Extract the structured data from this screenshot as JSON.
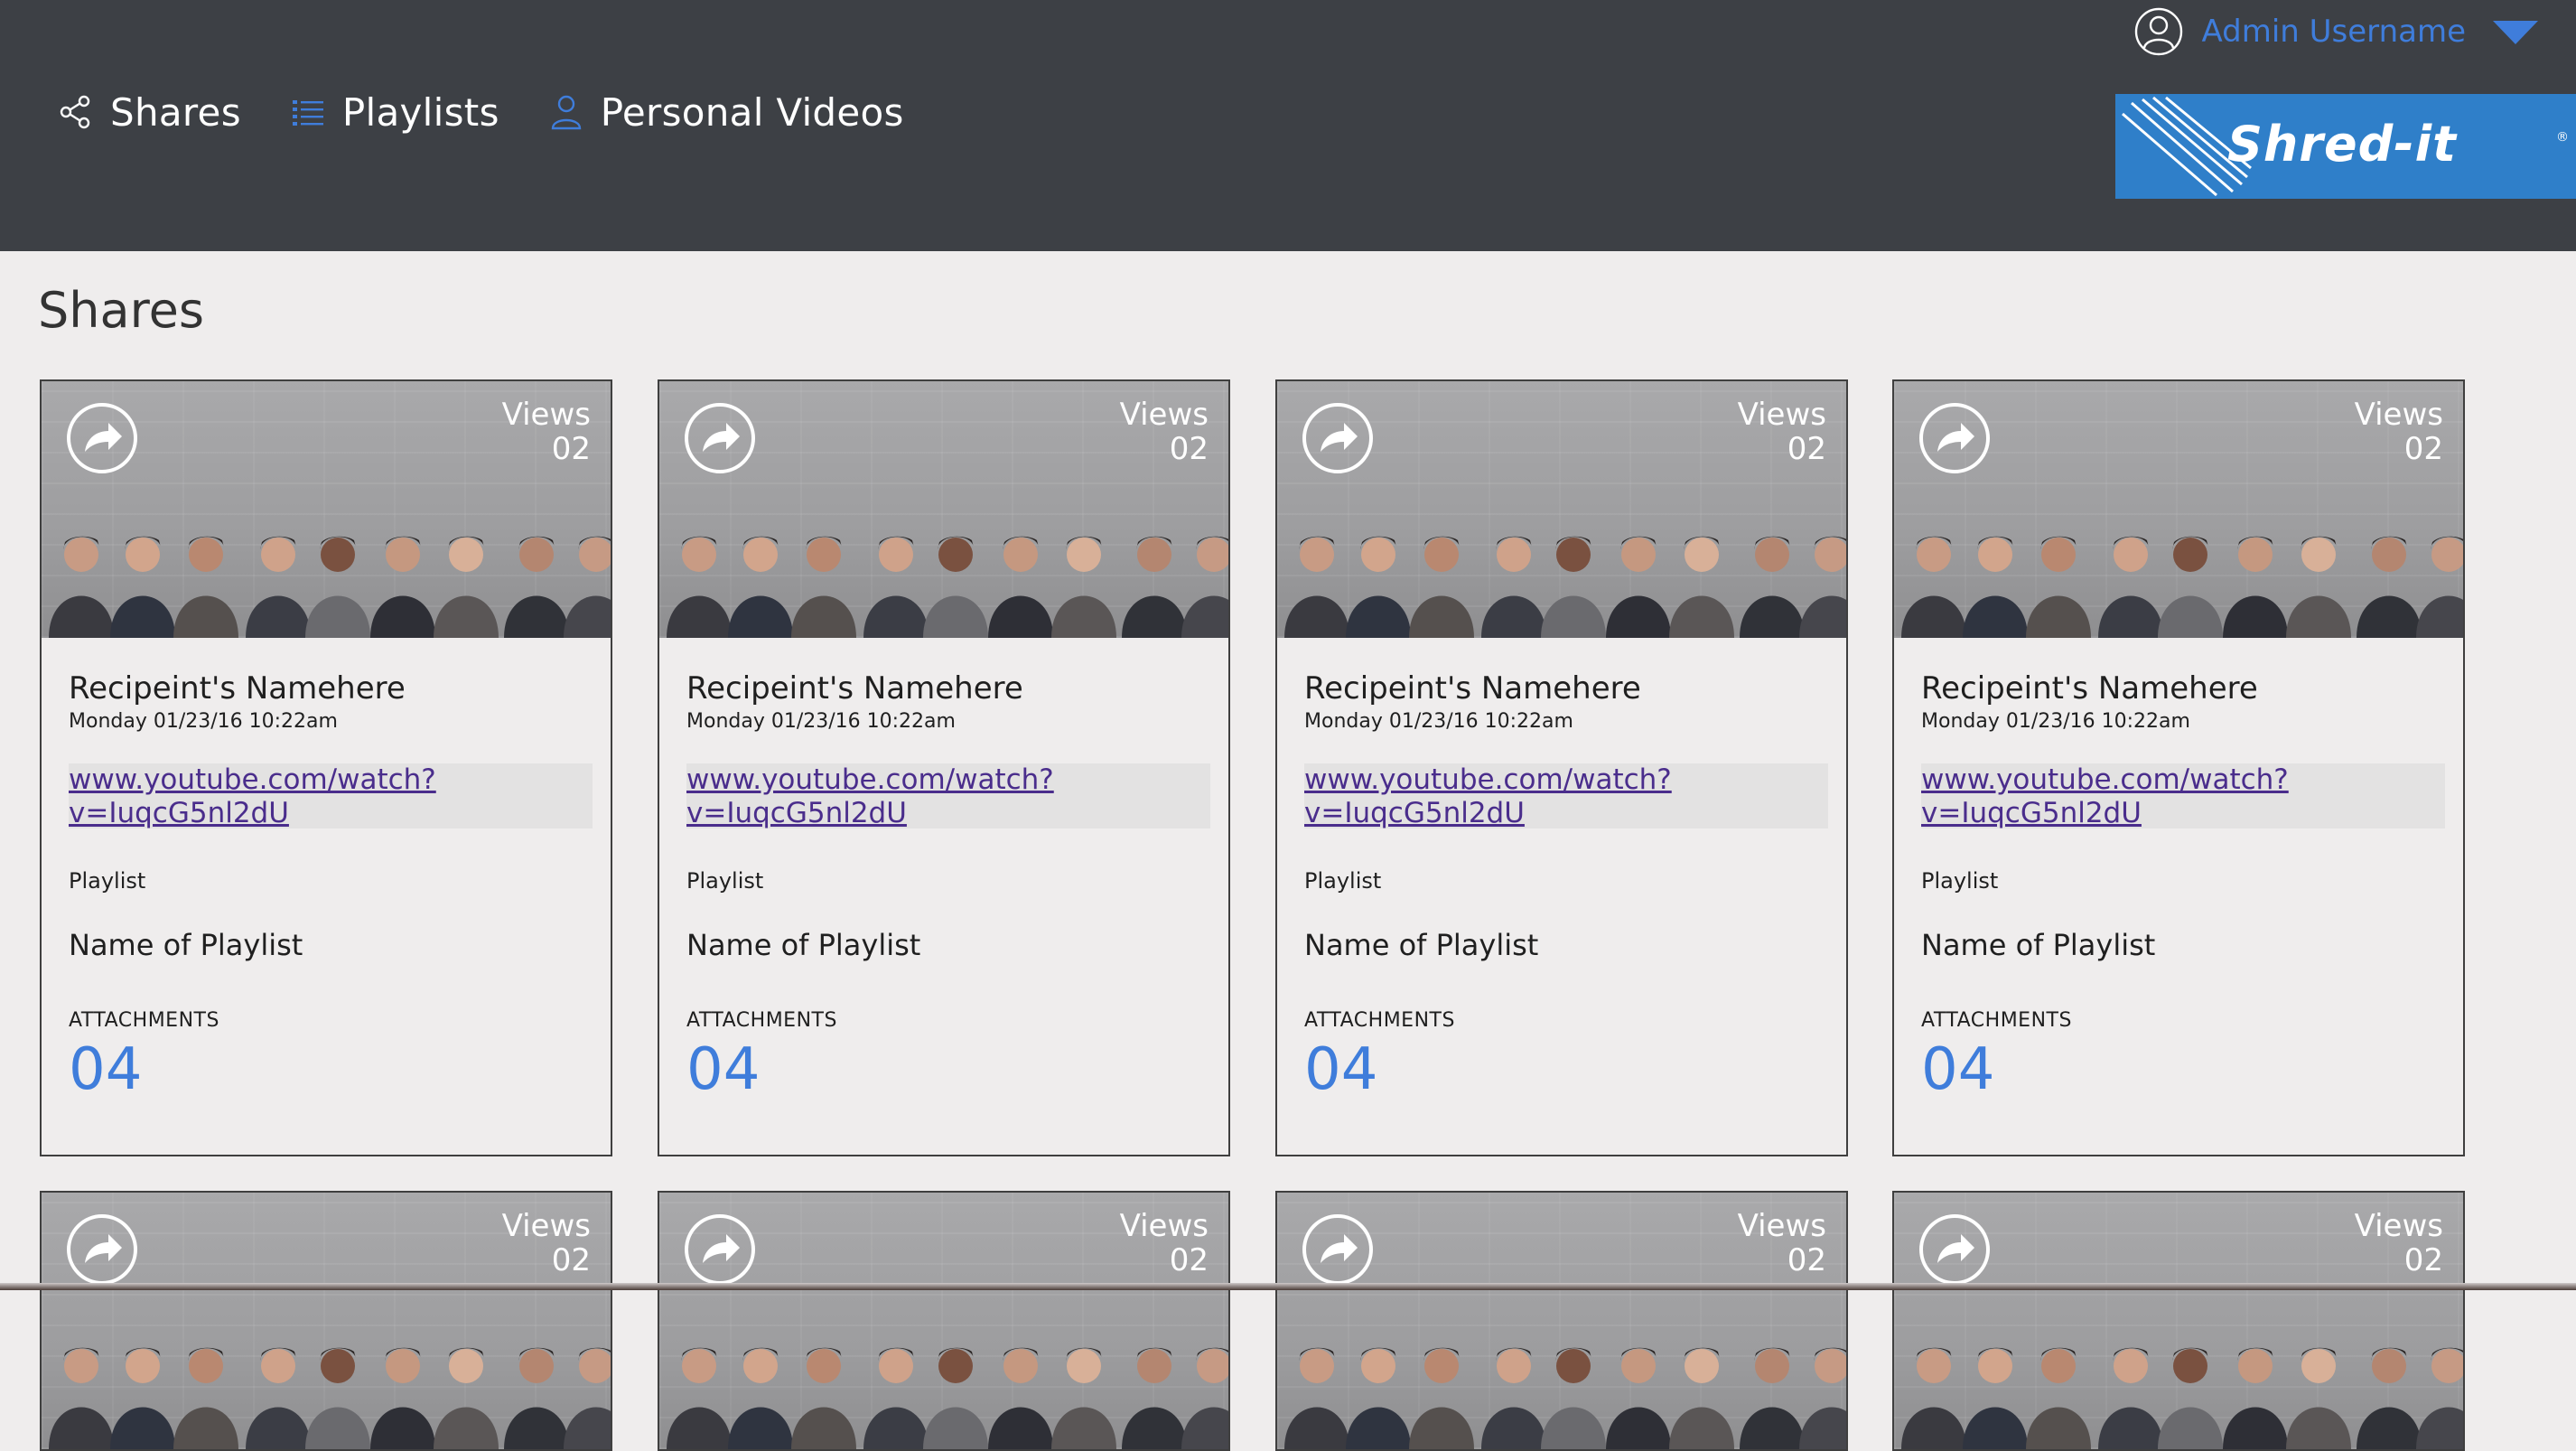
{
  "nav": {
    "items": [
      {
        "label": "Shares",
        "icon": "share-icon"
      },
      {
        "label": "Playlists",
        "icon": "list-icon"
      },
      {
        "label": "Personal Videos",
        "icon": "person-icon"
      }
    ]
  },
  "user": {
    "name": "Admin Username",
    "icon": "user-avatar-icon"
  },
  "logo": {
    "text": "Shred-it",
    "reg": "®"
  },
  "page": {
    "title": "Shares"
  },
  "colors": {
    "header_bg": "#3d4045",
    "accent": "#3f7ddb",
    "link": "#4a2d8c",
    "page_bg": "#efeded",
    "logo_bg": "#2f7fc9"
  },
  "cards": [
    {
      "views_label": "Views",
      "views": "02",
      "recipient": "Recipeint's Namehere",
      "date": "Monday 01/23/16 10:22am",
      "link_line1": "www.youtube.com/watch?",
      "link_line2": "v=IuqcG5nl2dU",
      "playlist_label": "Playlist",
      "playlist_name": "Name of Playlist",
      "attachments_label": "ATTACHMENTS",
      "attachments": "04"
    },
    {
      "views_label": "Views",
      "views": "02",
      "recipient": "Recipeint's Namehere",
      "date": "Monday 01/23/16 10:22am",
      "link_line1": "www.youtube.com/watch?",
      "link_line2": "v=IuqcG5nl2dU",
      "playlist_label": "Playlist",
      "playlist_name": "Name of Playlist",
      "attachments_label": "ATTACHMENTS",
      "attachments": "04"
    },
    {
      "views_label": "Views",
      "views": "02",
      "recipient": "Recipeint's Namehere",
      "date": "Monday 01/23/16 10:22am",
      "link_line1": "www.youtube.com/watch?",
      "link_line2": "v=IuqcG5nl2dU",
      "playlist_label": "Playlist",
      "playlist_name": "Name of Playlist",
      "attachments_label": "ATTACHMENTS",
      "attachments": "04"
    },
    {
      "views_label": "Views",
      "views": "02",
      "recipient": "Recipeint's Namehere",
      "date": "Monday 01/23/16 10:22am",
      "link_line1": "www.youtube.com/watch?",
      "link_line2": "v=IuqcG5nl2dU",
      "playlist_label": "Playlist",
      "playlist_name": "Name of Playlist",
      "attachments_label": "ATTACHMENTS",
      "attachments": "04"
    },
    {
      "views_label": "Views",
      "views": "02"
    },
    {
      "views_label": "Views",
      "views": "02"
    },
    {
      "views_label": "Views",
      "views": "02"
    },
    {
      "views_label": "Views",
      "views": "02"
    }
  ]
}
